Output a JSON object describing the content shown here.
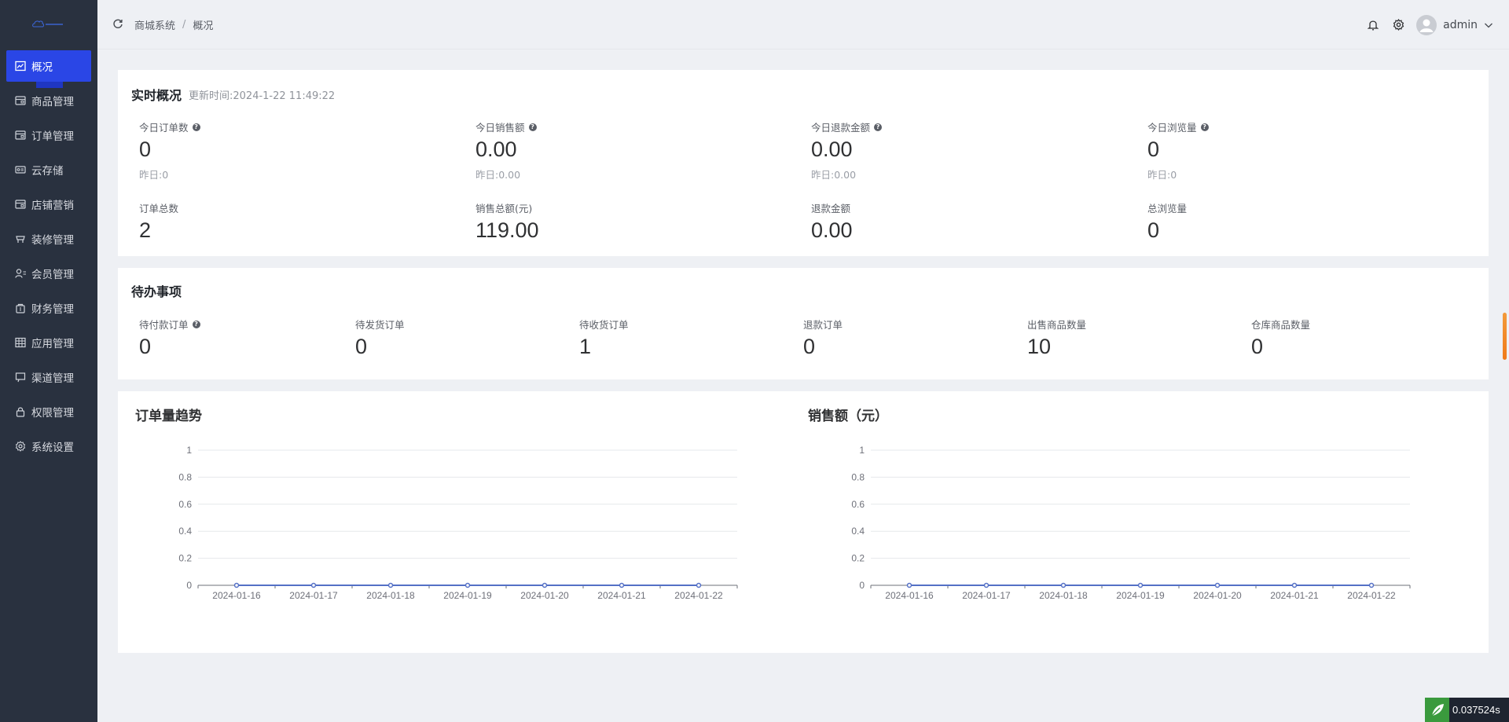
{
  "sidebar": {
    "items": [
      {
        "label": "概况",
        "icon": "chart-icon",
        "active": true
      },
      {
        "label": "商品管理",
        "icon": "goods-icon"
      },
      {
        "label": "订单管理",
        "icon": "order-icon"
      },
      {
        "label": "云存储",
        "icon": "cloud-storage-icon"
      },
      {
        "label": "店铺营销",
        "icon": "marketing-icon"
      },
      {
        "label": "装修管理",
        "icon": "decoration-icon"
      },
      {
        "label": "会员管理",
        "icon": "member-icon"
      },
      {
        "label": "财务管理",
        "icon": "finance-icon"
      },
      {
        "label": "应用管理",
        "icon": "apps-icon"
      },
      {
        "label": "渠道管理",
        "icon": "channel-icon"
      },
      {
        "label": "权限管理",
        "icon": "lock-icon"
      },
      {
        "label": "系统设置",
        "icon": "gear-icon"
      }
    ]
  },
  "header": {
    "breadcrumb": [
      "商城系统",
      "概况"
    ],
    "separator": "/",
    "username": "admin"
  },
  "realtime": {
    "title": "实时概况",
    "update_time": "更新时间:2024-1-22 11:49:22",
    "today": [
      {
        "label": "今日订单数",
        "value": "0",
        "yesterday": "昨日:0",
        "help": true
      },
      {
        "label": "今日销售额",
        "value": "0.00",
        "yesterday": "昨日:0.00",
        "help": true
      },
      {
        "label": "今日退款金额",
        "value": "0.00",
        "yesterday": "昨日:0.00",
        "help": true
      },
      {
        "label": "今日浏览量",
        "value": "0",
        "yesterday": "昨日:0",
        "help": true
      }
    ],
    "totals": [
      {
        "label": "订单总数",
        "value": "2"
      },
      {
        "label": "销售总额(元)",
        "value": "119.00"
      },
      {
        "label": "退款金额",
        "value": "0.00"
      },
      {
        "label": "总浏览量",
        "value": "0"
      }
    ]
  },
  "todo": {
    "title": "待办事项",
    "items": [
      {
        "label": "待付款订单",
        "value": "0",
        "help": true
      },
      {
        "label": "待发货订单",
        "value": "0"
      },
      {
        "label": "待收货订单",
        "value": "1"
      },
      {
        "label": "退款订单",
        "value": "0"
      },
      {
        "label": "出售商品数量",
        "value": "10"
      },
      {
        "label": "仓库商品数量",
        "value": "0"
      }
    ]
  },
  "chart_data": [
    {
      "type": "line",
      "title": "订单量趋势",
      "categories": [
        "2024-01-16",
        "2024-01-17",
        "2024-01-18",
        "2024-01-19",
        "2024-01-20",
        "2024-01-21",
        "2024-01-22"
      ],
      "values": [
        0,
        0,
        0,
        0,
        0,
        0,
        0
      ],
      "yticks": [
        "0",
        "0.2",
        "0.4",
        "0.6",
        "0.8",
        "1"
      ],
      "ylim": [
        0,
        1
      ],
      "grid": true,
      "color": "#5470c6"
    },
    {
      "type": "line",
      "title": "销售额（元）",
      "categories": [
        "2024-01-16",
        "2024-01-17",
        "2024-01-18",
        "2024-01-19",
        "2024-01-20",
        "2024-01-21",
        "2024-01-22"
      ],
      "values": [
        0,
        0,
        0,
        0,
        0,
        0,
        0
      ],
      "yticks": [
        "0",
        "0.2",
        "0.4",
        "0.6",
        "0.8",
        "1"
      ],
      "ylim": [
        0,
        1
      ],
      "grid": true,
      "color": "#5470c6"
    }
  ],
  "perf_badge": "0.037524s",
  "colors": {
    "sidebar_bg": "#29313f",
    "active": "#2a46e6",
    "page_bg": "#eef0f4"
  }
}
